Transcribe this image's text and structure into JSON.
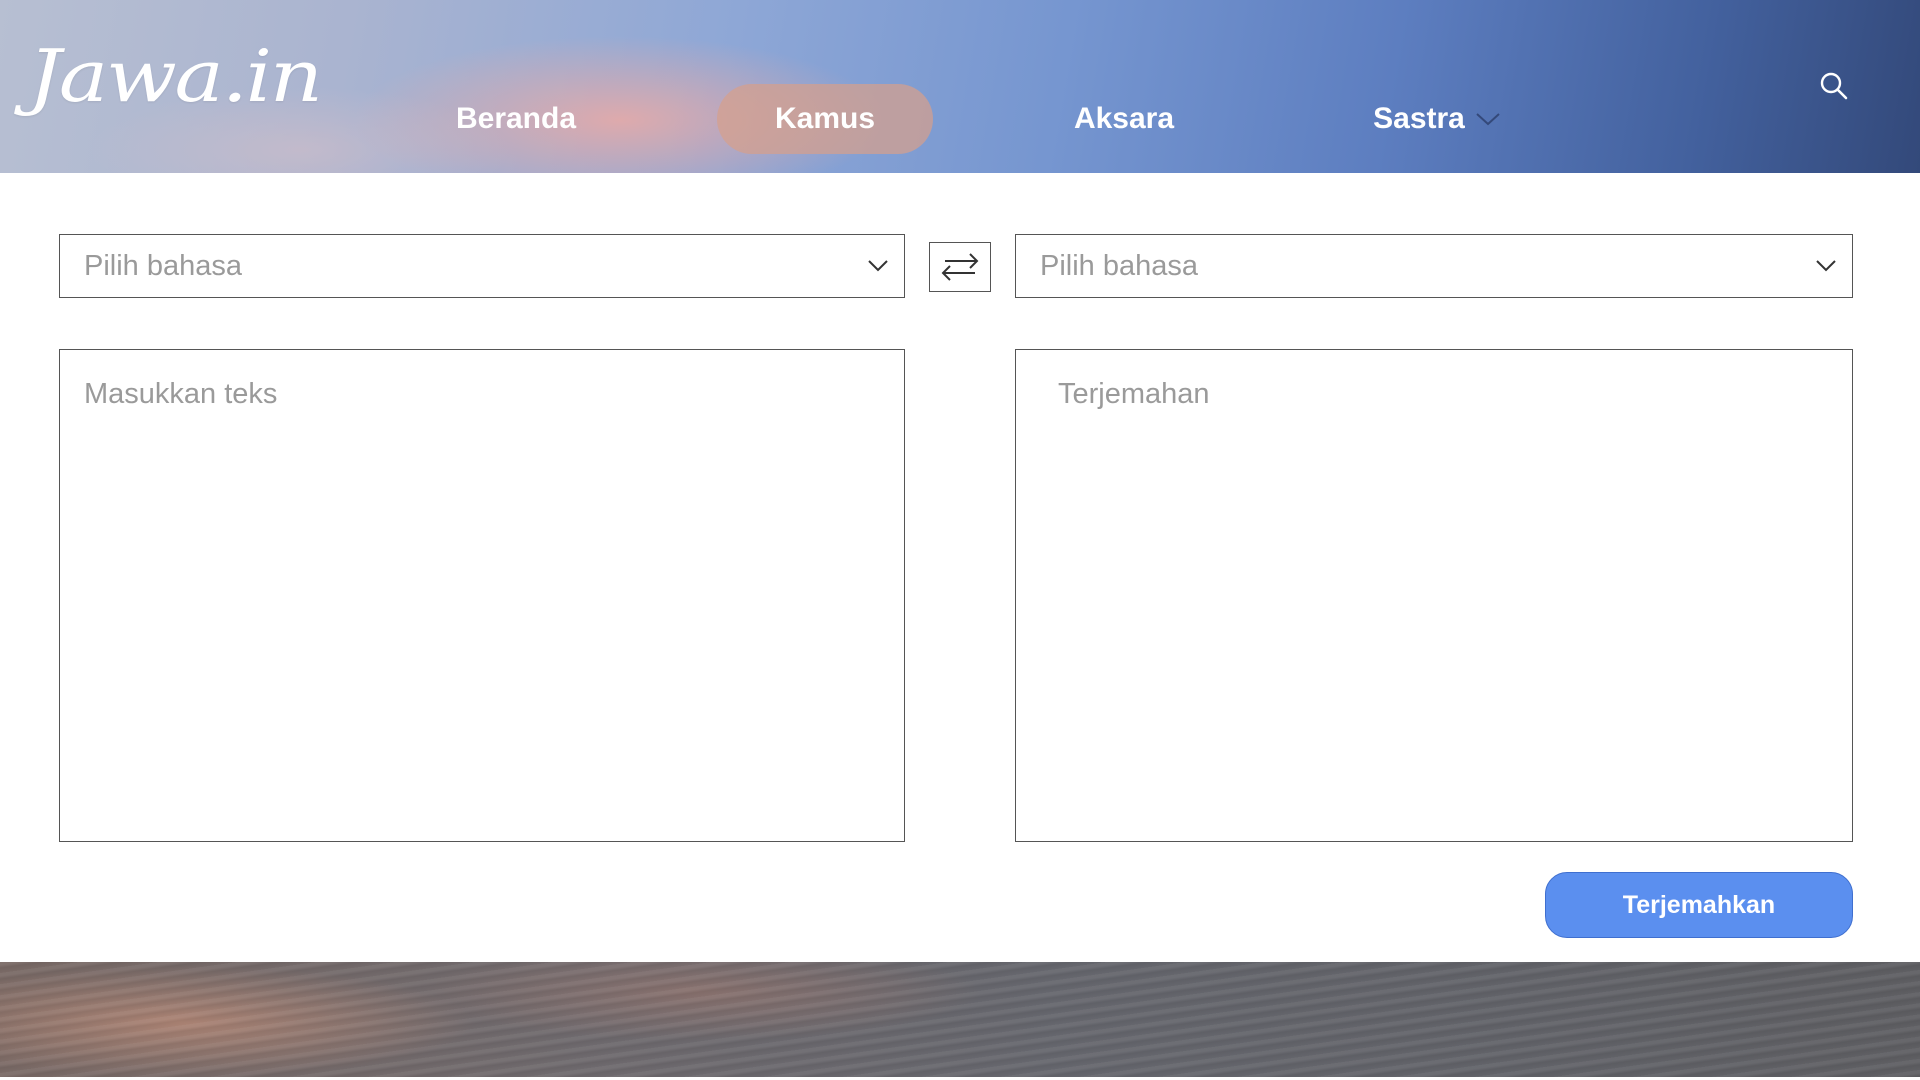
{
  "header": {
    "logo_text": "Jawa.in",
    "nav": {
      "beranda": "Beranda",
      "kamus": "Kamus",
      "aksara": "Aksara",
      "sastra": "Sastra"
    },
    "active_nav": "kamus",
    "icons": {
      "search": "search-icon",
      "sastra_dropdown": "chevron-down-icon"
    }
  },
  "translator": {
    "source_language": {
      "placeholder": "Pilih bahasa",
      "selected": ""
    },
    "target_language": {
      "placeholder": "Pilih bahasa",
      "selected": ""
    },
    "swap_icon": "swap-arrows-icon",
    "input": {
      "placeholder": "Masukkan teks",
      "value": ""
    },
    "output": {
      "placeholder": "Terjemahan",
      "value": ""
    },
    "translate_button": "Terjemahkan"
  },
  "colors": {
    "accent_button": "#5b8fef",
    "active_nav_pill": "#d6a08c",
    "placeholder_text": "#9a9a9a"
  }
}
